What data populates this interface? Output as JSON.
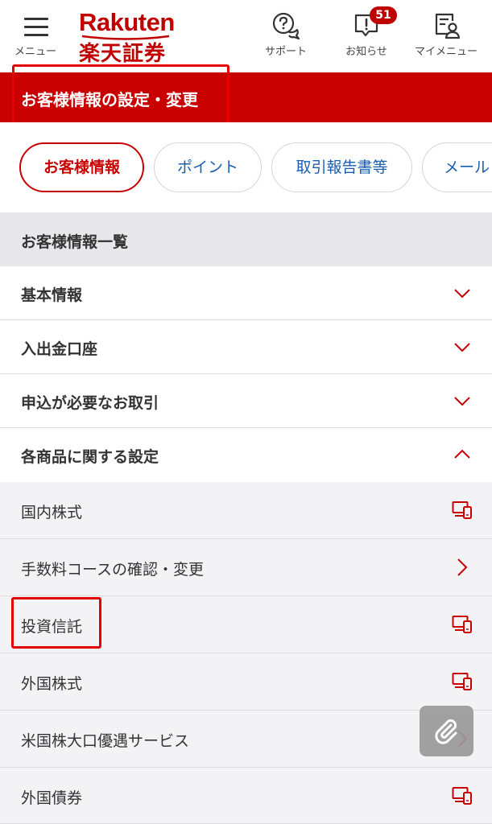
{
  "header": {
    "menu_label": "メニュー",
    "logo_en": "Rakuten",
    "logo_jp": "楽天証券",
    "support_label": "サポート",
    "notice_label": "お知らせ",
    "notice_badge": "51",
    "mymenu_label": "マイメニュー"
  },
  "page_title": "お客様情報の設定・変更",
  "tabs": [
    {
      "label": "お客様情報",
      "active": true
    },
    {
      "label": "ポイント",
      "active": false
    },
    {
      "label": "取引報告書等",
      "active": false
    },
    {
      "label": "メール",
      "active": false
    }
  ],
  "section_title": "お客様情報一覧",
  "accordion": [
    {
      "label": "基本情報",
      "state": "collapsed"
    },
    {
      "label": "入出金口座",
      "state": "collapsed"
    },
    {
      "label": "申込が必要なお取引",
      "state": "collapsed"
    },
    {
      "label": "各商品に関する設定",
      "state": "expanded"
    }
  ],
  "sub_items": [
    {
      "label": "国内株式",
      "icon": "pc-smartphone-icon"
    },
    {
      "label": "手数料コースの確認・変更",
      "icon": "chevron-right-icon"
    },
    {
      "label": "投資信託",
      "icon": "pc-smartphone-icon"
    },
    {
      "label": "外国株式",
      "icon": "pc-smartphone-icon"
    },
    {
      "label": "米国株大口優遇サービス",
      "icon": "chevron-right-icon"
    },
    {
      "label": "外国債券",
      "icon": "pc-smartphone-icon"
    }
  ],
  "colors": {
    "brand_red": "#c80000",
    "link_blue": "#1a5eb0",
    "annotation_red": "#e50000"
  }
}
